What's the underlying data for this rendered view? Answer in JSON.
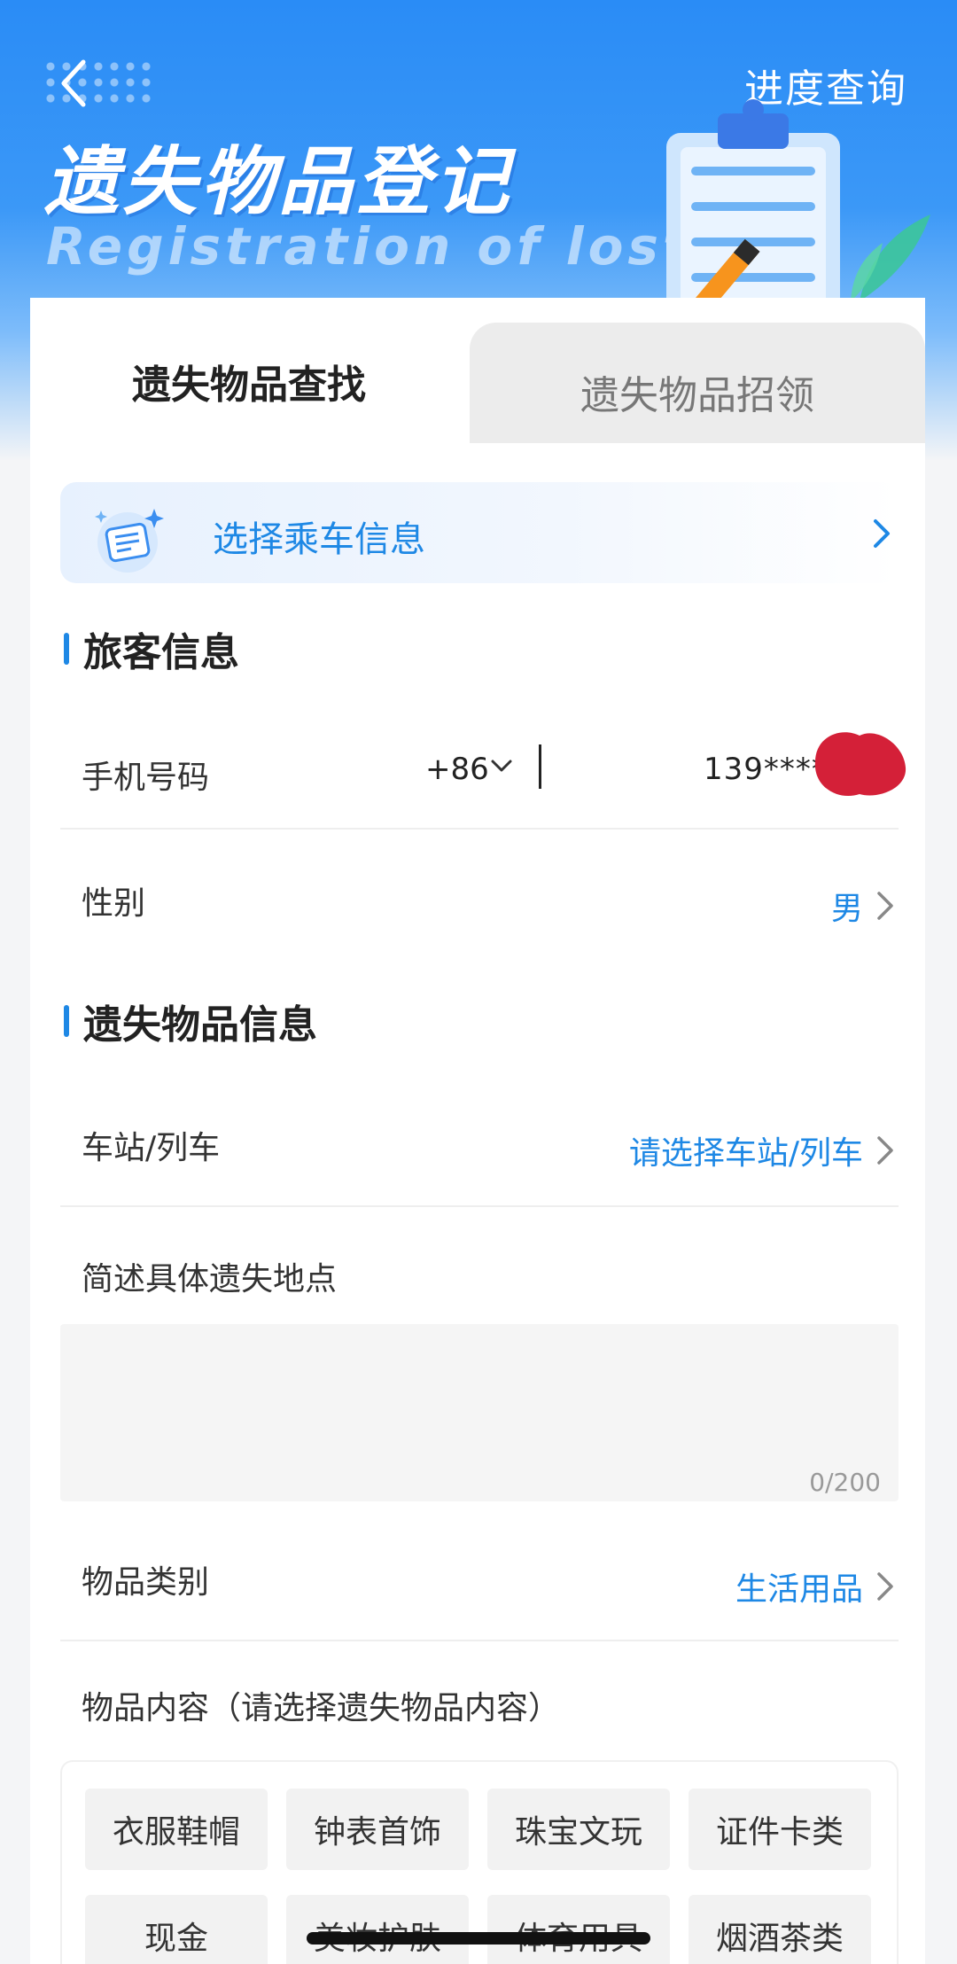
{
  "header": {
    "progress_link": "进度查询",
    "title": "遗失物品登记",
    "subtitle": "Registration of lost"
  },
  "tabs": [
    {
      "label": "遗失物品查找",
      "active": true
    },
    {
      "label": "遗失物品招领",
      "active": false
    }
  ],
  "trip_banner": {
    "label": "选择乘车信息"
  },
  "passenger_section": {
    "title": "旅客信息",
    "phone": {
      "label": "手机号码",
      "country_code": "+86",
      "value": "139****6"
    },
    "gender": {
      "label": "性别",
      "value": "男"
    }
  },
  "item_section": {
    "title": "遗失物品信息",
    "station": {
      "label": "车站/列车",
      "placeholder": "请选择车站/列车"
    },
    "location": {
      "label": "简述具体遗失地点",
      "counter": "0/200"
    },
    "category": {
      "label": "物品类别",
      "value": "生活用品"
    },
    "content": {
      "label": "物品内容（请选择遗失物品内容）"
    },
    "content_options": [
      "衣服鞋帽",
      "钟表首饰",
      "珠宝文玩",
      "证件卡类",
      "现金",
      "美妆护肤",
      "体育用具",
      "烟酒茶类"
    ]
  },
  "colors": {
    "accent": "#1e88e5",
    "hero_top": "#2a8cf6"
  }
}
